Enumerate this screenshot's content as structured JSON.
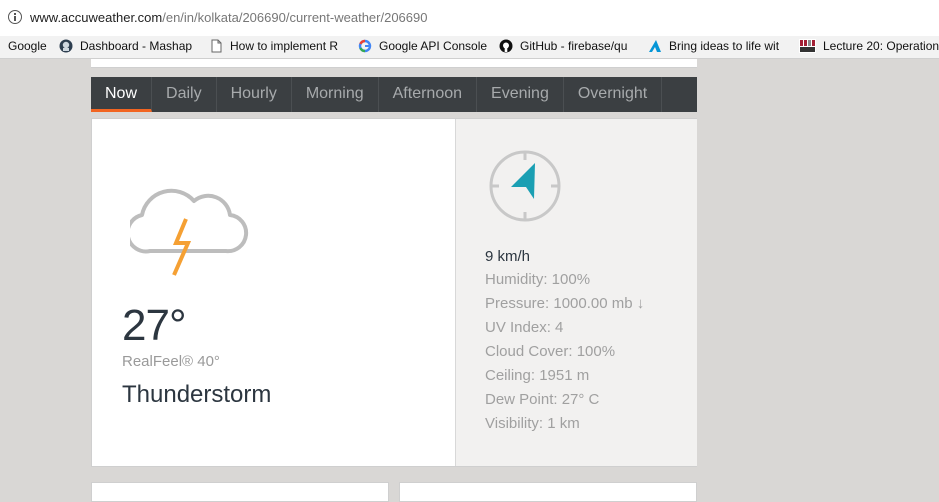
{
  "browser": {
    "url_host": "www.accuweather.com",
    "url_path": "/en/in/kolkata/206690/current-weather/206690",
    "bookmarks": [
      {
        "label": "Google",
        "icon": "google-apps-icon"
      },
      {
        "label": "Dashboard - Mashape",
        "icon": "mashape-icon"
      },
      {
        "label": "How to implement R",
        "icon": "page-icon"
      },
      {
        "label": "Google API Console",
        "icon": "google-g-icon"
      },
      {
        "label": "GitHub - firebase/qu",
        "icon": "github-icon"
      },
      {
        "label": "Bring ideas to life wit",
        "icon": "autodesk-icon"
      },
      {
        "label": "Lecture 20: Operation",
        "icon": "mit-ocw-icon"
      }
    ]
  },
  "tabs": [
    "Now",
    "Daily",
    "Hourly",
    "Morning",
    "Afternoon",
    "Evening",
    "Overnight"
  ],
  "current": {
    "temperature": "27°",
    "realfeel": "RealFeel® 40°",
    "phrase": "Thunderstorm",
    "icon": "thunderstorm-icon"
  },
  "details": {
    "wind": "9 km/h",
    "items": [
      "Humidity: 100%",
      "Pressure: 1000.00 mb ↓",
      "UV Index: 4",
      "Cloud Cover: 100%",
      "Ceiling: 1951 m",
      "Dew Point: 27° C",
      "Visibility: 1 km"
    ]
  },
  "colors": {
    "accent": "#f26522",
    "tab_bg": "#3b3f42",
    "compass_arrow": "#1a9fb3",
    "text_dark": "#2c3640",
    "text_muted": "#a0a0a0"
  }
}
